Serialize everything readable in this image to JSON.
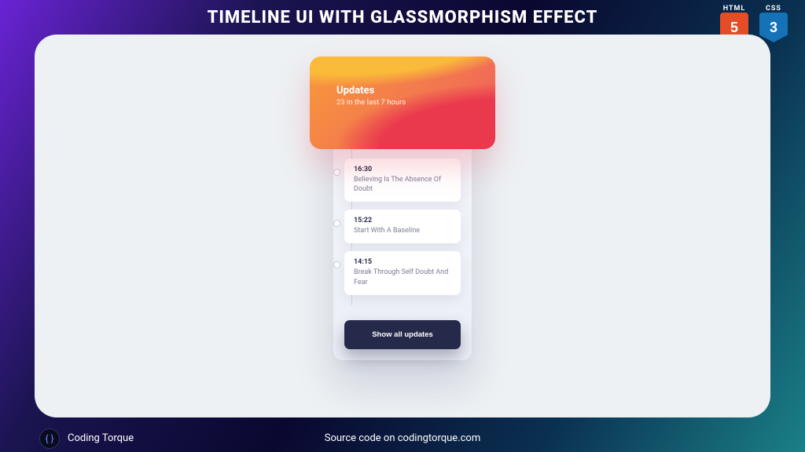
{
  "page": {
    "title": "TIMELINE UI WITH GLASSMORPHISM EFFECT"
  },
  "badges": {
    "html": "HTML",
    "css": "CSS"
  },
  "widget": {
    "header": {
      "title": "Updates",
      "subtitle": "23 in the last 7 hours"
    },
    "items": [
      {
        "time": "16:30",
        "label": "Believing Is The Absence Of Doubt"
      },
      {
        "time": "15:22",
        "label": "Start With A Baseline"
      },
      {
        "time": "14:15",
        "label": "Break Through Self Doubt And Fear"
      }
    ],
    "button": "Show all updates"
  },
  "footer": {
    "credit": "Coding Torque",
    "source": "Source code on codingtorque.com"
  }
}
